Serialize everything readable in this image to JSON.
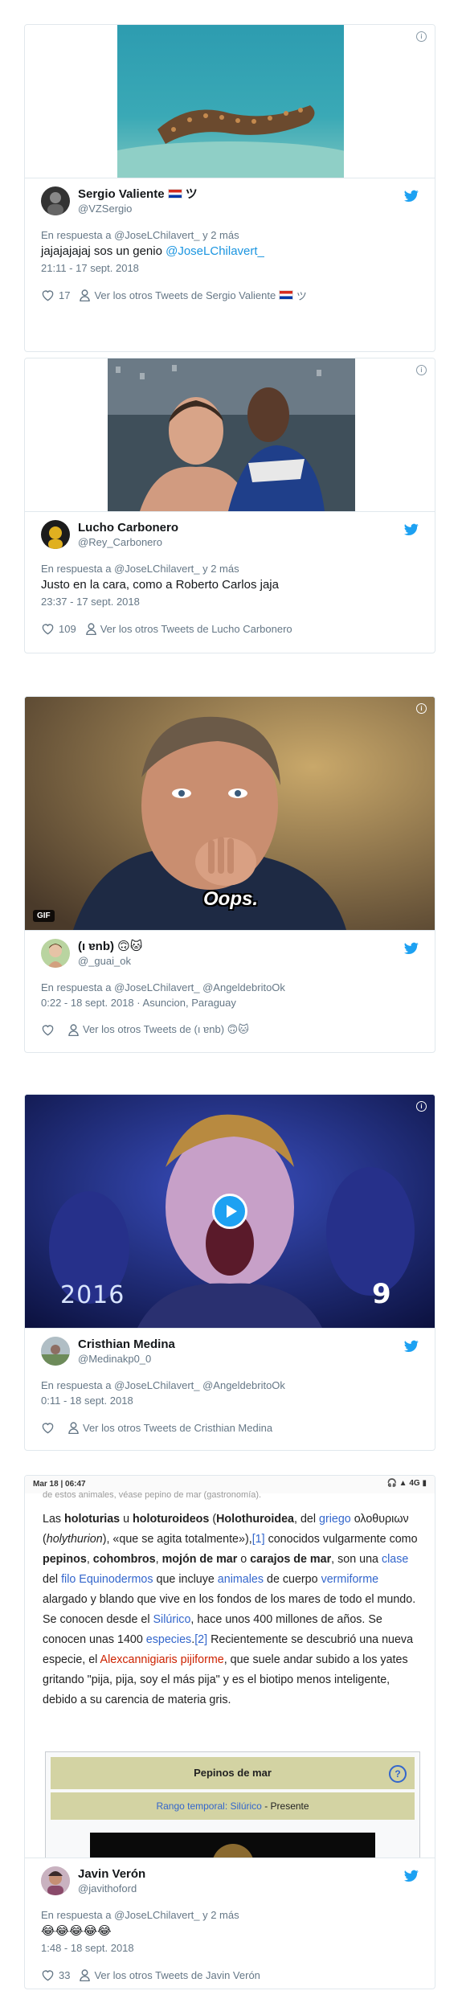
{
  "colors": {
    "link": "#1b95e0",
    "secondary_text": "#657786",
    "primary_text": "#14171a",
    "border": "#e1e8ed",
    "twitter_blue": "#1da1f2",
    "paraguay_flag": [
      "#d52b1e",
      "#ffffff",
      "#0038a8"
    ]
  },
  "icons": {
    "info": "info-icon",
    "twitter": "twitter-bird-icon",
    "like": "heart-icon",
    "profile": "person-icon",
    "play": "play-icon"
  },
  "tweets": [
    {
      "media_desc": "sea-cucumber-photo",
      "name": "Sergio Valiente",
      "name_suffix": "ツ",
      "handle": "@VZSergio",
      "reply_prefix": "En respuesta a",
      "reply_to": "@JoseLChilavert_ y 2 más",
      "text": "jajajajajaj sos un genio",
      "mention": "@JoseLChilavert_",
      "time": "21:11 - 17 sept. 2018",
      "likes": "17",
      "others": "Ver los otros Tweets de Sergio Valiente",
      "others_suffix": "ツ"
    },
    {
      "media_desc": "football-players-photo",
      "name": "Lucho Carbonero",
      "handle": "@Rey_Carbonero",
      "reply_prefix": "En respuesta a",
      "reply_to": "@JoseLChilavert_ y 2 más",
      "text": "Justo en la cara, como a Roberto Carlos jaja",
      "time": "23:37 - 17 sept. 2018",
      "likes": "109",
      "others": "Ver los otros Tweets de Lucho Carbonero"
    },
    {
      "media_desc": "house-oops-gif",
      "gif_badge": "GIF",
      "caption": "Oops.",
      "name": "(ı ɐnb) 🙃🐱",
      "handle": "@_guai_ok",
      "reply_prefix": "En respuesta a",
      "reply_to": "@JoseLChilavert_ @AngeldebritoOk",
      "time": "0:22 - 18 sept. 2018",
      "location": "Asuncion, Paraguay",
      "likes": "",
      "others": "Ver los otros Tweets de (ı ɐnb) 🙃🐱"
    },
    {
      "media_desc": "shocked-crowd-video",
      "video_mark_left": "2016",
      "video_mark_right": "9",
      "name": "Cristhian Medina",
      "handle": "@Medinakp0_0",
      "reply_prefix": "En respuesta a",
      "reply_to": "@JoseLChilavert_ @AngeldebritoOk",
      "time": "0:11 - 18 sept. 2018",
      "likes": "",
      "others": "Ver los otros Tweets de Cristhian Medina"
    },
    {
      "media_desc": "wikipedia-screenshot",
      "status_time": "Mar 18 | 06:47",
      "status_right": "4G",
      "wiki_top": "de estos animales, véase pepino de mar (gastronomía).",
      "wiki_paragraph": [
        {
          "t": "Las "
        },
        {
          "t": "holoturias",
          "b": true
        },
        {
          "t": " u "
        },
        {
          "t": "holoturoideos",
          "b": true
        },
        {
          "t": " ("
        },
        {
          "t": "Holothuroidea",
          "b": true
        },
        {
          "t": ", del "
        },
        {
          "t": "griego",
          "l": true
        },
        {
          "t": " ολοθυριων ("
        },
        {
          "t": "holythurion",
          "i": true
        },
        {
          "t": "), «que se agita totalmente»),"
        },
        {
          "t": "[1]",
          "l": true
        },
        {
          "t": " conocidos vulgarmente como "
        },
        {
          "t": "pepinos",
          "b": true
        },
        {
          "t": ", "
        },
        {
          "t": "cohombros",
          "b": true
        },
        {
          "t": ", "
        },
        {
          "t": "mojón de mar",
          "b": true
        },
        {
          "t": " o "
        },
        {
          "t": "carajos de mar",
          "b": true
        },
        {
          "t": ", son una "
        },
        {
          "t": "clase",
          "l": true
        },
        {
          "t": " del "
        },
        {
          "t": "filo Equinodermos",
          "l": true
        },
        {
          "t": " que incluye "
        },
        {
          "t": "animales",
          "l": true
        },
        {
          "t": " de cuerpo "
        },
        {
          "t": "vermiforme",
          "l": true
        },
        {
          "t": " alargado y blando que vive en los fondos de los mares de todo el mundo. Se conocen desde el "
        },
        {
          "t": "Silúrico",
          "l": true
        },
        {
          "t": ", hace unos 400 millones de años. Se conocen unas 1400 "
        },
        {
          "t": "especies",
          "l": true
        },
        {
          "t": ".",
          "x": true
        },
        {
          "t": "[2]",
          "l": true
        },
        {
          "t": " Recientemente se descubrió una nueva especie, el "
        },
        {
          "t": "Alexcannigiaris pijiforme",
          "r": true
        },
        {
          "t": ", que suele andar subido a los yates gritando \"pija, pija, soy el más pija\" y es el biotipo menos inteligente, debido a su carencia de materia gris."
        }
      ],
      "infobox_title": "Pepinos de mar",
      "infobox_range_label": "Rango temporal:",
      "infobox_range_link": "Silúrico",
      "infobox_range_end": " - Presente",
      "name": "Javin Verón",
      "handle": "@javithoford",
      "reply_prefix": "En respuesta a",
      "reply_to": "@JoseLChilavert_ y 2 más",
      "text": "😂😂😂😂😂",
      "time": "1:48 - 18 sept. 2018",
      "likes": "33",
      "others": "Ver los otros Tweets de Javin Verón"
    }
  ]
}
